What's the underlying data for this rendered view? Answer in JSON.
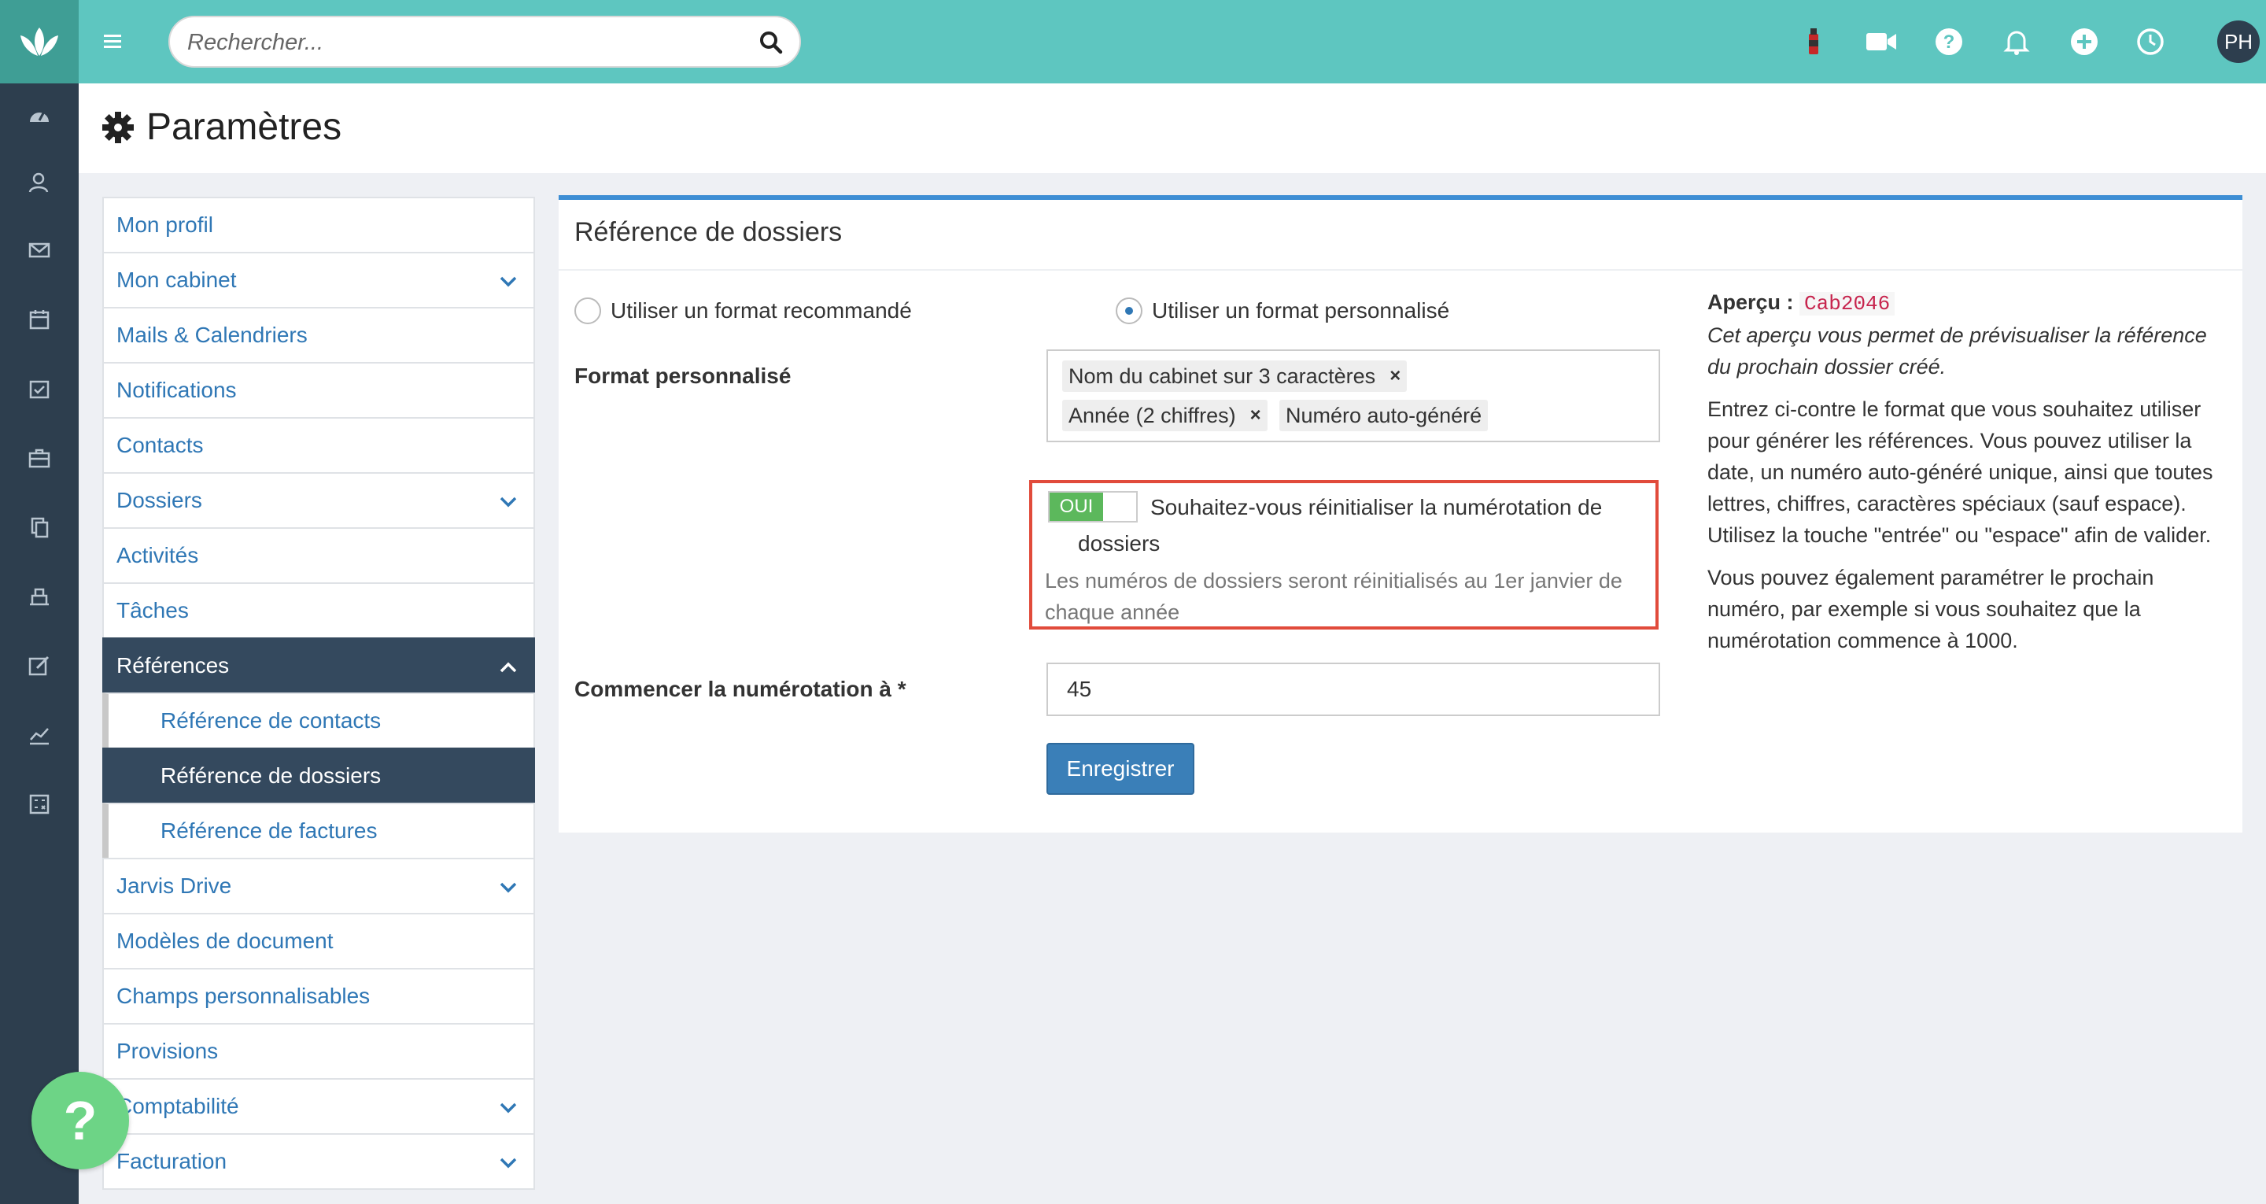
{
  "search": {
    "placeholder": "Rechercher..."
  },
  "topbar": {
    "avatar_initials": "PH"
  },
  "page": {
    "title": "Paramètres"
  },
  "menu": {
    "items": [
      {
        "label": "Mon profil"
      },
      {
        "label": "Mon cabinet"
      },
      {
        "label": "Mails & Calendriers"
      },
      {
        "label": "Notifications"
      },
      {
        "label": "Contacts"
      },
      {
        "label": "Dossiers"
      },
      {
        "label": "Activités"
      },
      {
        "label": "Tâches"
      },
      {
        "label": "Références"
      },
      {
        "label": "Référence de contacts"
      },
      {
        "label": "Référence de dossiers"
      },
      {
        "label": "Référence de factures"
      },
      {
        "label": "Jarvis Drive"
      },
      {
        "label": "Modèles de document"
      },
      {
        "label": "Champs personnalisables"
      },
      {
        "label": "Provisions"
      },
      {
        "label": "Comptabilité"
      },
      {
        "label": "Facturation"
      }
    ]
  },
  "help": {
    "label": "?"
  },
  "panel": {
    "title": "Référence de dossiers",
    "radio_recommended": "Utiliser un format recommandé",
    "radio_custom": "Utiliser un format personnalisé",
    "format_label": "Format personnalisé",
    "tags": [
      "Nom du cabinet sur 3 caractères",
      "Année (2 chiffres)",
      "Numéro auto-généré"
    ],
    "tag_remove": "×",
    "toggle_label": "OUI",
    "reset_question": "Souhaitez-vous réinitialiser la numérotation de dossiers",
    "reset_hint": "Les numéros de dossiers seront réinitialisés au 1er janvier de chaque année",
    "start_label": "Commencer la numérotation à *",
    "start_value": "45",
    "save_label": "Enregistrer"
  },
  "aside": {
    "preview_label": "Aperçu :",
    "preview_value": "Cab2046",
    "preview_desc": "Cet aperçu vous permet de prévisualiser la référence du prochain dossier créé.",
    "help1": "Entrez ci-contre le format que vous souhaitez utiliser pour générer les références. Vous pouvez utiliser la date, un numéro auto-généré unique, ainsi que toutes lettres, chiffres, caractères spéciaux (sauf espace).",
    "help2": "Utilisez la touche \"entrée\" ou \"espace\" afin de valider.",
    "help3": "Vous pouvez également paramétrer le prochain numéro, par exemple si vous souhaitez que la numérotation commence à 1000."
  }
}
